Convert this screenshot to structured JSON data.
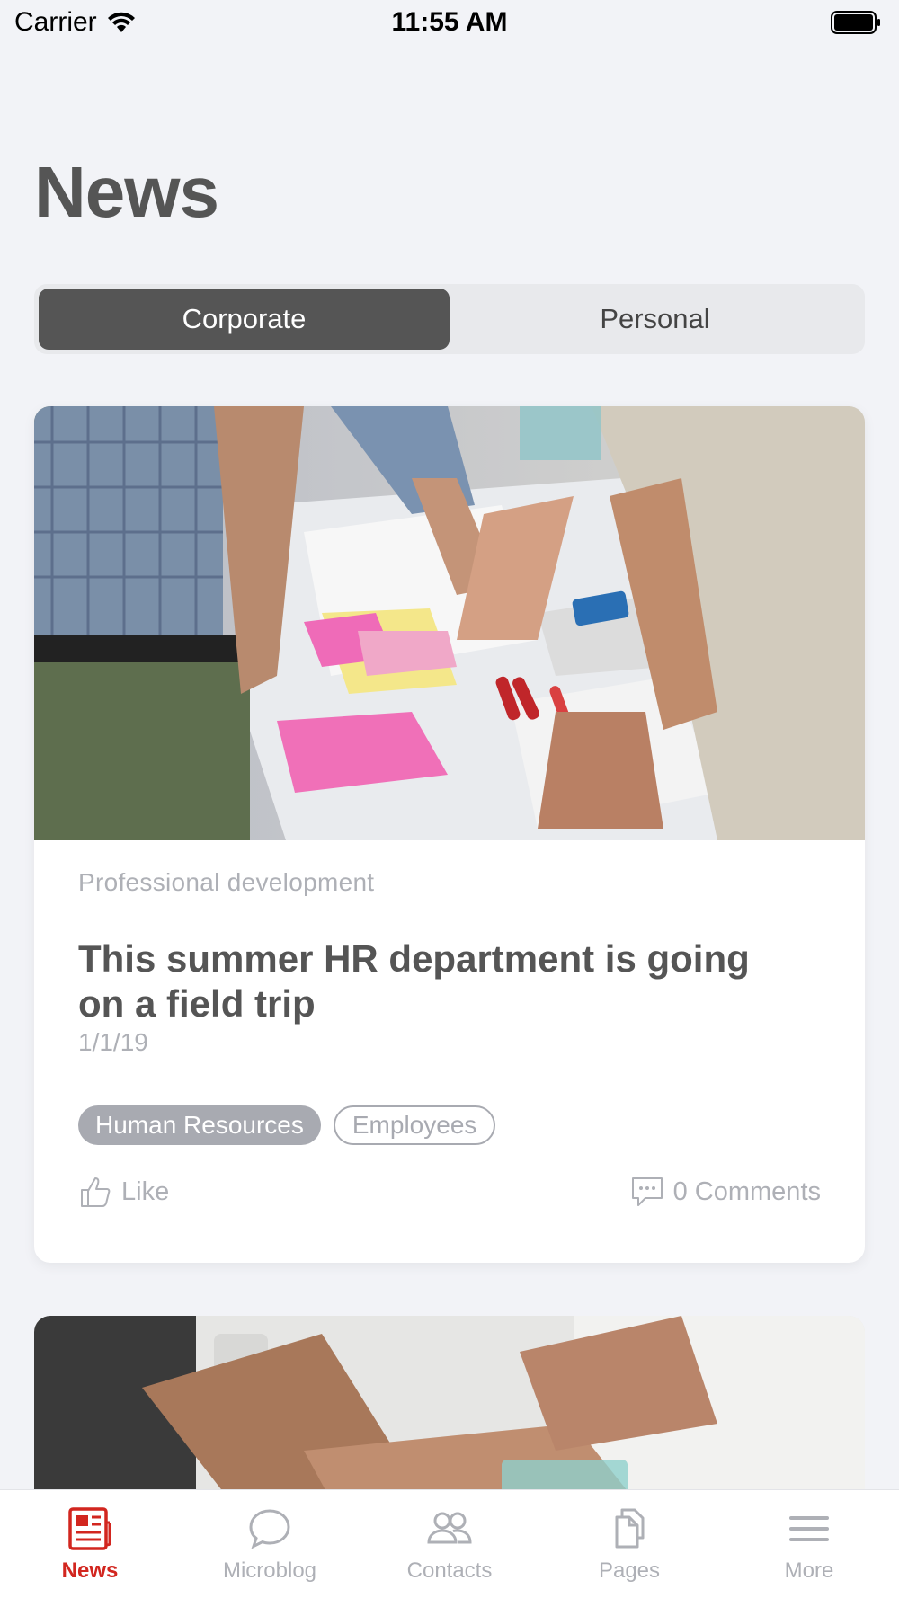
{
  "status_bar": {
    "carrier": "Carrier",
    "time": "11:55 AM"
  },
  "page": {
    "title": "News"
  },
  "segments": {
    "corporate": "Corporate",
    "personal": "Personal",
    "selected": "Corporate"
  },
  "articles": [
    {
      "category": "Professional development",
      "title": "This summer HR department is going on a field trip",
      "date": "1/1/19",
      "tags": [
        "Human Resources",
        "Employees"
      ],
      "like_label": "Like",
      "comments_label": "0 Comments"
    }
  ],
  "tab_bar": {
    "items": [
      {
        "label": "News",
        "icon": "newspaper-icon",
        "active": true
      },
      {
        "label": "Microblog",
        "icon": "chat-bubble-icon",
        "active": false
      },
      {
        "label": "Contacts",
        "icon": "people-icon",
        "active": false
      },
      {
        "label": "Pages",
        "icon": "pages-icon",
        "active": false
      },
      {
        "label": "More",
        "icon": "menu-icon",
        "active": false
      }
    ]
  },
  "colors": {
    "accent": "#d2261f",
    "segment_active": "#555555",
    "muted_text": "#aeb0b6",
    "background": "#f2f3f7"
  }
}
